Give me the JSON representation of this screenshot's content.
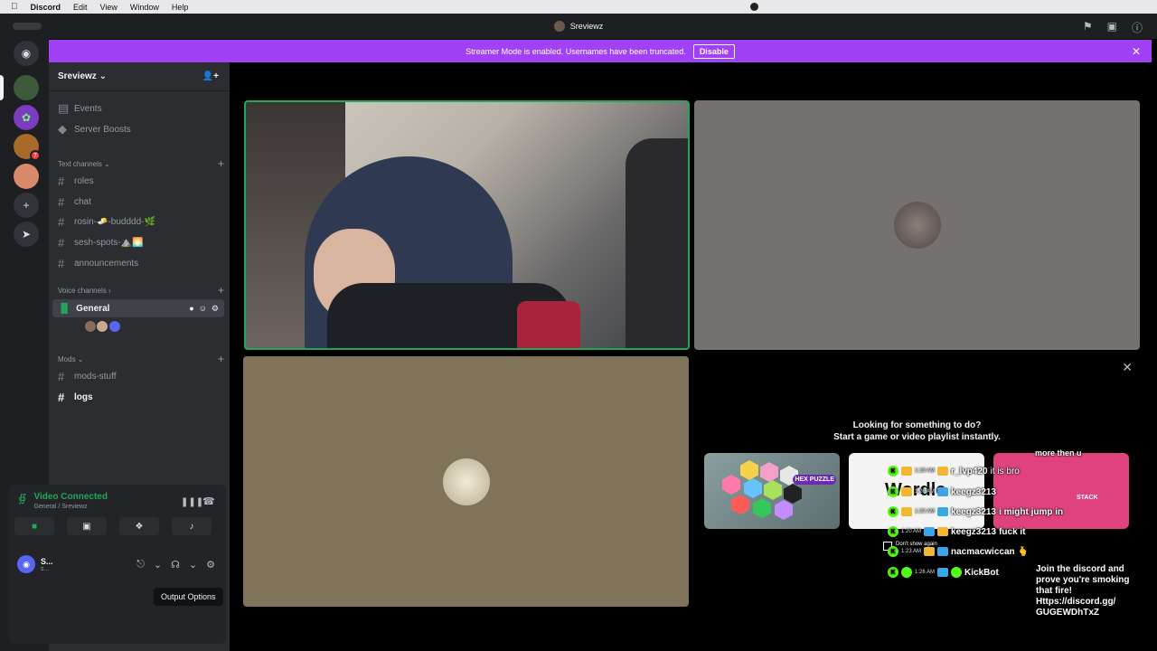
{
  "menubar": {
    "app": "Discord",
    "items": [
      "Edit",
      "View",
      "Window",
      "Help"
    ]
  },
  "window": {
    "title": "Sreviewz"
  },
  "banner": {
    "text": "Streamer Mode is enabled. Usernames have been truncated.",
    "button": "Disable"
  },
  "server": {
    "name": "Sreviewz",
    "top_items": [
      {
        "label": "Events",
        "icon": "calendar-icon"
      },
      {
        "label": "Server Boosts",
        "icon": "boost-icon"
      }
    ],
    "categories": {
      "text": "Text channels",
      "voice": "Voice channels",
      "mods": "Mods"
    },
    "text_channels": [
      "roles",
      "chat",
      "rosin-🧈-budddd-🌿",
      "sesh-spots-⛰️🌅",
      "announcements"
    ],
    "voice_channel": "General",
    "mod_channels": [
      "mods-stuff",
      "logs"
    ]
  },
  "voice_panel": {
    "status": "Video Connected",
    "location": "General / Sreviewz"
  },
  "user": {
    "name": "S...",
    "sub": "s..."
  },
  "tooltip": "Output Options",
  "activity": {
    "heading_line1": "Looking for something to do?",
    "heading_line2": "Start a game or video playlist instantly.",
    "cards": [
      "HEX PUZZLE",
      "Wordle",
      "STACK"
    ]
  },
  "chat": {
    "lines": [
      {
        "user": "r_lvp420",
        "msg": "it is bro",
        "time": "1:19 AM"
      },
      {
        "user": "keegz3213",
        "msg": "",
        "time": "1:20 AM"
      },
      {
        "user": "keegz3213",
        "msg": "i might jump in",
        "time": "1:20 AM"
      },
      {
        "user": "keegz3213",
        "msg": "fuck it",
        "time": "1:20 AM"
      },
      {
        "user": "nacmacwiccan",
        "msg": "🫰",
        "time": "1:23 AM"
      },
      {
        "user": "KickBot",
        "msg": "",
        "time": "1:26 AM"
      }
    ],
    "top_fragment": "more then u",
    "bot_message": "Join the discord and prove you're smoking that fire! Https://discord.gg/ GUGEWDhTxZ",
    "hidden_line": "Don't show again"
  },
  "colors": {
    "accent": "#a041f5",
    "connected": "#23a55a",
    "kick": "#53fc18"
  }
}
